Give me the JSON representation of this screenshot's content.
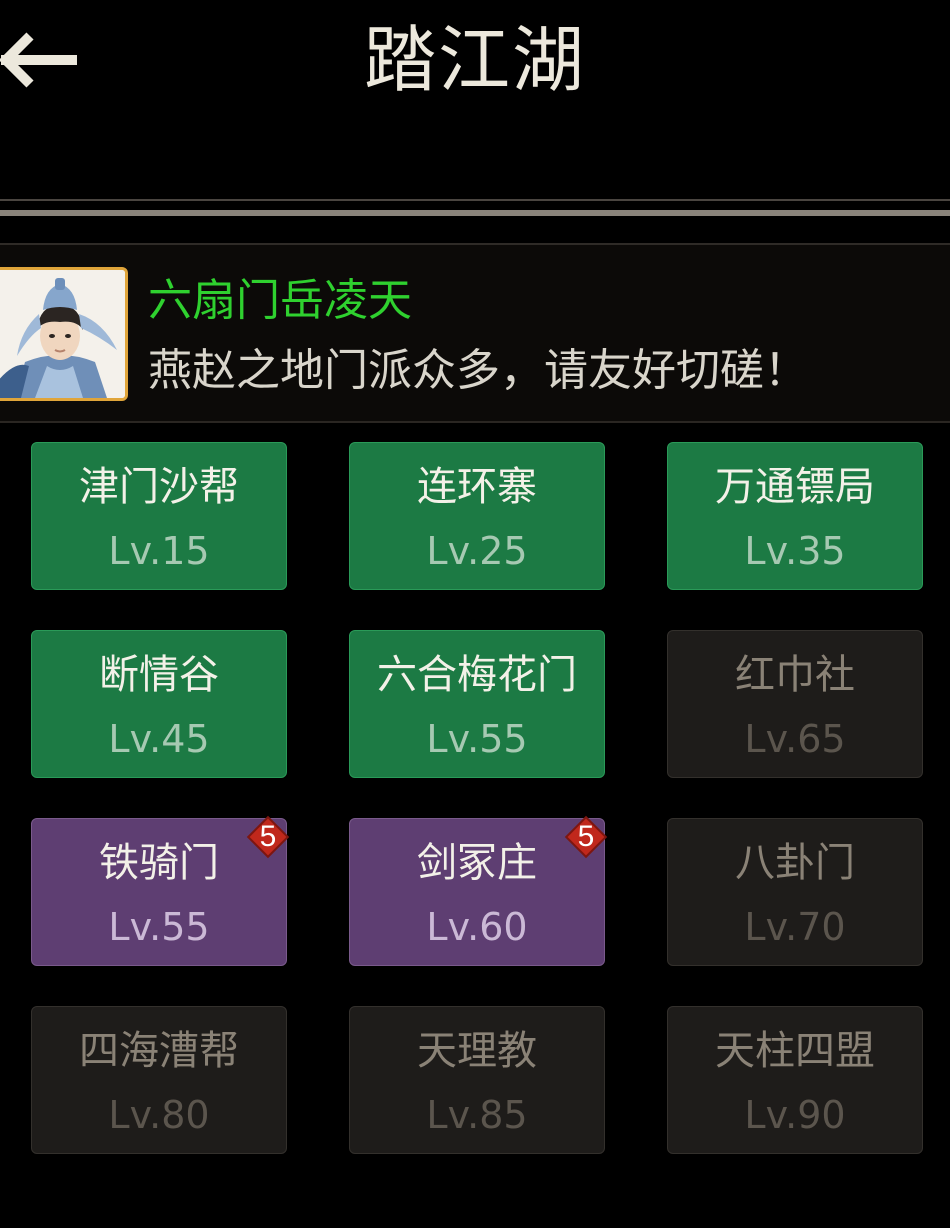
{
  "header": {
    "back_icon": "left-arrow-icon",
    "title": "踏江湖"
  },
  "npc": {
    "portrait_icon": "swordsman-portrait",
    "name": "六扇门岳凌天",
    "message": "燕赵之地门派众多，请友好切磋！",
    "name_color": "#2fd12f"
  },
  "sects": [
    {
      "name": "津门沙帮",
      "level": "Lv.15",
      "state": "unlocked"
    },
    {
      "name": "连环寨",
      "level": "Lv.25",
      "state": "unlocked"
    },
    {
      "name": "万通镖局",
      "level": "Lv.35",
      "state": "unlocked"
    },
    {
      "name": "断情谷",
      "level": "Lv.45",
      "state": "unlocked"
    },
    {
      "name": "六合梅花门",
      "level": "Lv.55",
      "state": "unlocked"
    },
    {
      "name": "红巾社",
      "level": "Lv.65",
      "state": "locked"
    },
    {
      "name": "铁骑门",
      "level": "Lv.55",
      "state": "special",
      "badge": "5"
    },
    {
      "name": "剑冢庄",
      "level": "Lv.60",
      "state": "special",
      "badge": "5"
    },
    {
      "name": "八卦门",
      "level": "Lv.70",
      "state": "locked"
    },
    {
      "name": "四海漕帮",
      "level": "Lv.80",
      "state": "locked"
    },
    {
      "name": "天理教",
      "level": "Lv.85",
      "state": "locked"
    },
    {
      "name": "天柱四盟",
      "level": "Lv.90",
      "state": "locked"
    }
  ],
  "colors": {
    "unlocked": "#1c7a44",
    "special": "#5e3e72",
    "locked": "#1e1c1a",
    "badge": "#c0281c"
  }
}
